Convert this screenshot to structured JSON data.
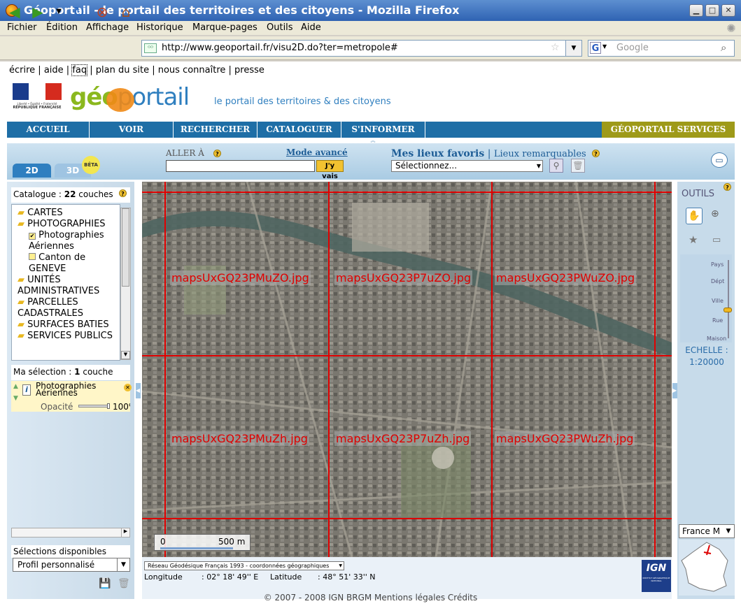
{
  "window": {
    "title": "Géoportail - le portail des territoires et des citoyens - Mozilla Firefox"
  },
  "menu": [
    "Fichier",
    "Édition",
    "Affichage",
    "Historique",
    "Marque-pages",
    "Outils",
    "Aide"
  ],
  "nav": {
    "url": "http://www.geoportail.fr/visu2D.do?ter=metropole#",
    "search_placeholder": "Google"
  },
  "toplinks": [
    "écrire",
    "aide",
    "faq",
    "plan du site",
    "nous connaître",
    "presse"
  ],
  "logo": {
    "republique": "RÉPUBLIQUE FRANÇAISE",
    "liberte": "Liberté • Égalité • Fraternité",
    "geo": "géo",
    "portail": "portail",
    "tagline": "le portail des territoires & des citoyens"
  },
  "mainnav": [
    "ACCUEIL",
    "VOIR",
    "RECHERCHER",
    "CATALOGUER",
    "S'INFORMER"
  ],
  "services": "GÉOPORTAIL SERVICES",
  "toolbar": {
    "tab2d": "2D",
    "tab3d": "3D",
    "beta": "BÊTA",
    "aller": "ALLER À",
    "mode_avance": "Mode avancé",
    "jyvais": "J'y vais",
    "favoris": "Mes lieux favoris",
    "sep": "|",
    "remarquables": "Lieux remarquables",
    "fav_select": "Sélectionnez..."
  },
  "catalog": {
    "label": "Catalogue :",
    "count": "22",
    "unit": "couches",
    "items": [
      {
        "label": "CARTES",
        "kind": "folder"
      },
      {
        "label": "PHOTOGRAPHIES",
        "kind": "folder"
      },
      {
        "label": "Photographies Aériennes",
        "kind": "checked"
      },
      {
        "label": "Canton de GENEVE",
        "kind": "unchecked"
      },
      {
        "label": "UNITÉS ADMINISTRATIVES",
        "kind": "folder"
      },
      {
        "label": "PARCELLES CADASTRALES",
        "kind": "folder"
      },
      {
        "label": "SURFACES BATIES",
        "kind": "folder"
      },
      {
        "label": "SERVICES PUBLICS",
        "kind": "folder"
      }
    ]
  },
  "selection": {
    "label": "Ma sélection :",
    "count": "1",
    "unit": "couche",
    "layer": "Photographies Aériennes",
    "opacity_label": "Opacité",
    "opacity": "100%"
  },
  "dispo": {
    "label": "Sélections disponibles",
    "value": "Profil personnalisé"
  },
  "map": {
    "tiles": [
      "mapsUxGQ23PMuZO.jpg",
      "mapsUxGQ23P7uZO.jpg",
      "mapsUxGQ23PWuZO.jpg",
      "mapsUxGQ23PMuZh.jpg",
      "mapsUxGQ23P7uZh.jpg",
      "mapsUxGQ23PWuZh.jpg"
    ],
    "scalebar_start": "0",
    "scalebar_label": "500 m"
  },
  "tools": {
    "title": "OUTILS",
    "zoom_levels": [
      "Pays",
      "Dépt",
      "Ville",
      "Rue",
      "Maison"
    ],
    "zoom_current": "Ville",
    "echelle_label": "ECHELLE :",
    "echelle_value": "1:20000",
    "region": "France M"
  },
  "coords": {
    "system": "Réseau Géodésique Français 1993 - coordonnées géographiques",
    "lon_label": "Longitude",
    "lon": ": 02° 18' 49'' E",
    "lat_label": "Latitude",
    "lat": ": 48° 51' 33'' N",
    "ign": "IGN",
    "ign_sub": "INSTITUT GÉOGRAPHIQUE NATIONAL"
  },
  "footer": "© 2007 - 2008 IGN BRGM Mentions légales Crédits"
}
